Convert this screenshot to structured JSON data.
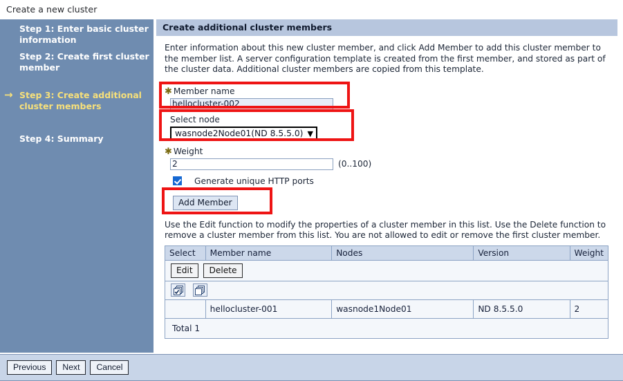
{
  "page": {
    "title": "Create a new cluster"
  },
  "step_nav": {
    "arrow_icon": "arrow-right-icon",
    "items": [
      {
        "label": "Step 1: Enter basic cluster information",
        "active": false
      },
      {
        "label": "Step 2: Create first cluster member",
        "active": false
      },
      {
        "label": "Step 3: Create additional cluster members",
        "active": true
      },
      {
        "label": "Step 4: Summary",
        "active": false
      }
    ]
  },
  "panel": {
    "title": "Create additional cluster members",
    "intro_text": "Enter information about this new cluster member, and click Add Member to add this cluster member to the member list. A server configuration template is created from the first member, and stored as part of the cluster data. Additional cluster members are copied from this template.",
    "table_help_text": "Use the Edit function to modify the properties of a cluster member in this list. Use the Delete function to remove a cluster member from this list. You are not allowed to edit or remove the first cluster member."
  },
  "form": {
    "required_marker": "✱",
    "member_name": {
      "label": "Member name",
      "value": "hellocluster-002",
      "placeholder": ""
    },
    "select_node": {
      "label": "Select node",
      "selected": "wasnode2Node01(ND 8.5.5.0)",
      "chevron_icon": "chevron-down-icon",
      "options": [
        "wasnode2Node01(ND 8.5.5.0)"
      ]
    },
    "weight": {
      "label": "Weight",
      "value": "2",
      "range_hint": "(0..100)"
    },
    "generate_ports": {
      "label": "Generate unique HTTP ports",
      "checked": true
    },
    "add_member_button": "Add Member"
  },
  "members_table": {
    "toolbar": {
      "edit_label": "Edit",
      "delete_label": "Delete",
      "select_all_icon": "select-all-icon",
      "deselect_all_icon": "deselect-all-icon"
    },
    "columns": [
      "Select",
      "Member name",
      "Nodes",
      "Version",
      "Weight"
    ],
    "rows": [
      {
        "select": "",
        "member_name": "hellocluster-001",
        "nodes": "wasnode1Node01",
        "version": "ND 8.5.5.0",
        "weight": "2"
      }
    ],
    "footer": "Total 1"
  },
  "action_bar": {
    "previous_label": "Previous",
    "next_label": "Next",
    "cancel_label": "Cancel"
  },
  "colors": {
    "nav_background": "#6f8cb0",
    "nav_text": "#ffffff",
    "nav_active_text": "#f7e07a",
    "panel_title_background": "#b7c6de",
    "annotation_red": "#ee1414",
    "action_bar_background": "#c8d5e8",
    "table_header_background": "#ccd8ea"
  }
}
